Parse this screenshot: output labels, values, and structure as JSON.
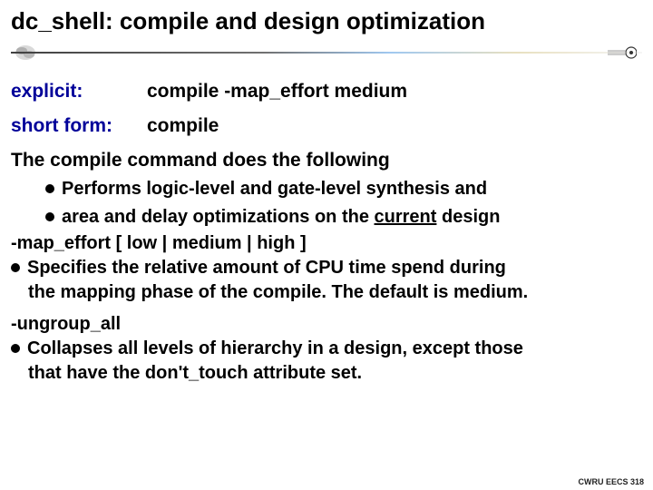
{
  "title": "dc_shell: compile and design optimization",
  "rows": {
    "explicit_label": "explicit:",
    "explicit_value": "compile -map_effort medium",
    "short_label": "short form:",
    "short_value": "compile"
  },
  "intro": "The compile command does the following",
  "bullets": {
    "b1": "Performs logic-level and gate-level synthesis and",
    "b2_pre": "area and delay optimizations on the ",
    "b2_under": "current",
    "b2_post": " design"
  },
  "options": {
    "map_heading": "-map_effort [ low | medium | high ]",
    "map_line1": "Specifies the relative amount of CPU time spend during",
    "map_line2": "the mapping phase of the compile. The default is medium.",
    "ungroup_heading": "-ungroup_all",
    "ungroup_line1": "Collapses all levels of hierarchy in a design, except those",
    "ungroup_line2": "that have the don't_touch attribute set."
  },
  "footer": "CWRU EECS 318"
}
